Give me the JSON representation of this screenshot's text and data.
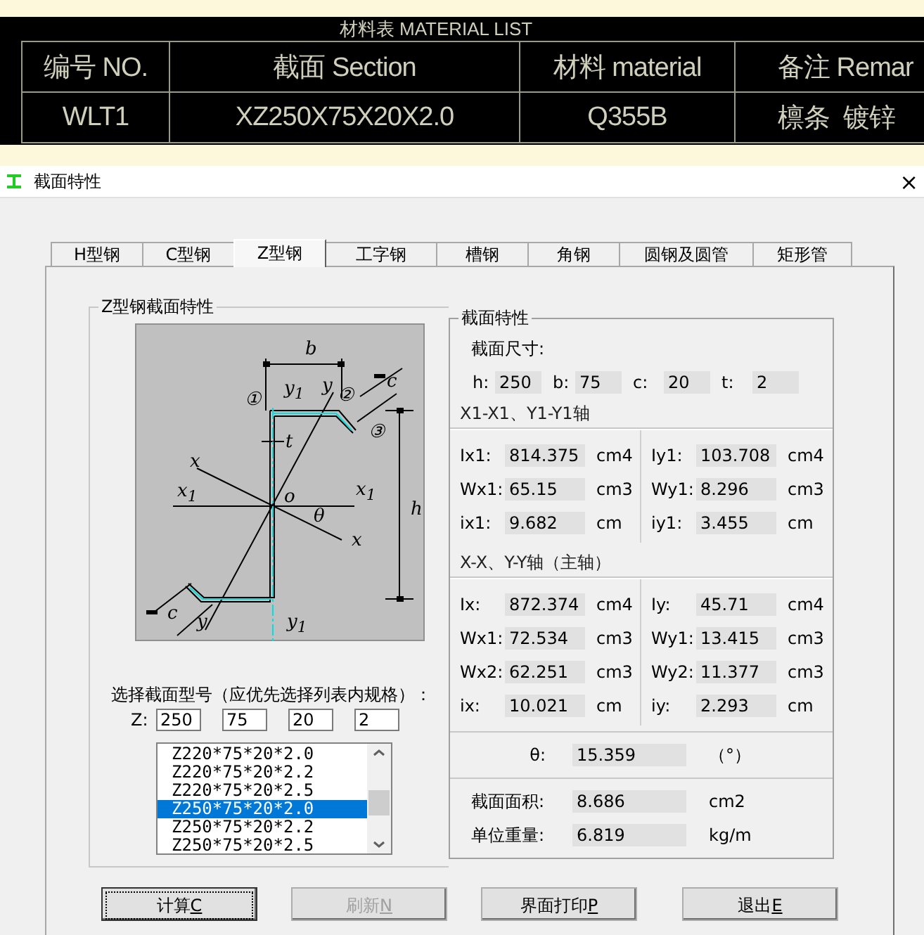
{
  "cad": {
    "title": "材料表 MATERIAL LIST",
    "columns": [
      "编号 NO.",
      "截面 Section",
      "材料 material",
      "备注 Remar"
    ],
    "row": [
      "WLT1",
      "XZ250X75X20X2.0",
      "Q355B",
      "檩条  镀锌"
    ]
  },
  "window": {
    "title": "截面特性",
    "close": "×"
  },
  "tabs": [
    {
      "label": "H型钢",
      "selected": false
    },
    {
      "label": "C型钢",
      "selected": false
    },
    {
      "label": "Z型钢",
      "selected": true
    },
    {
      "label": "工字钢",
      "selected": false
    },
    {
      "label": "槽钢",
      "selected": false
    },
    {
      "label": "角钢",
      "selected": false
    },
    {
      "label": "圆钢及圆管",
      "selected": false
    },
    {
      "label": "矩形管",
      "selected": false
    }
  ],
  "section_group": {
    "title": "Z型钢截面特性",
    "diagram_labels": [
      "b",
      "y$_{1}$",
      "y",
      "①",
      "②",
      "③",
      "c",
      "t",
      "x",
      "x$_{1}$",
      "o",
      "x$_{1}$",
      "θ",
      "x",
      "h",
      "c",
      "y",
      "y$_{1}$"
    ],
    "prompt": "选择截面型号（应优先选择列表内规格）：",
    "prefix": "Z:",
    "inputs": [
      "250",
      "75",
      "20",
      "2"
    ],
    "list": [
      {
        "label": "Z220*75*20*2.0",
        "selected": false
      },
      {
        "label": "Z220*75*20*2.2",
        "selected": false
      },
      {
        "label": "Z220*75*20*2.5",
        "selected": false
      },
      {
        "label": "Z250*75*20*2.0",
        "selected": true
      },
      {
        "label": "Z250*75*20*2.2",
        "selected": false
      },
      {
        "label": "Z250*75*20*2.5",
        "selected": false
      }
    ]
  },
  "properties": {
    "title": "截面特性",
    "size_label": "截面尺寸:",
    "dims": [
      {
        "label": "h:",
        "value": "250"
      },
      {
        "label": "b:",
        "value": "75"
      },
      {
        "label": "c:",
        "value": "20"
      },
      {
        "label": "t:",
        "value": "2"
      }
    ],
    "sections": [
      {
        "title": "X1-X1、Y1-Y1轴",
        "left": [
          {
            "label": "Ix1:",
            "value": "814.375",
            "unit": "cm4"
          },
          {
            "label": "Wx1:",
            "value": "65.15",
            "unit": "cm3"
          },
          {
            "label": "ix1:",
            "value": "9.682",
            "unit": "cm"
          }
        ],
        "right": [
          {
            "label": "Iy1:",
            "value": "103.708",
            "unit": "cm4"
          },
          {
            "label": "Wy1:",
            "value": "8.296",
            "unit": "cm3"
          },
          {
            "label": "iy1:",
            "value": "3.455",
            "unit": "cm"
          }
        ]
      },
      {
        "title": "X-X、Y-Y轴（主轴）",
        "left": [
          {
            "label": "Ix:",
            "value": "872.374",
            "unit": "cm4"
          },
          {
            "label": "Wx1:",
            "value": "72.534",
            "unit": "cm3"
          },
          {
            "label": "Wx2:",
            "value": "62.251",
            "unit": "cm3"
          },
          {
            "label": "ix:",
            "value": "10.021",
            "unit": "cm"
          }
        ],
        "right": [
          {
            "label": "Iy:",
            "value": "45.71",
            "unit": "cm4"
          },
          {
            "label": "Wy1:",
            "value": "13.415",
            "unit": "cm3"
          },
          {
            "label": "Wy2:",
            "value": "11.377",
            "unit": "cm3"
          },
          {
            "label": "iy:",
            "value": "2.293",
            "unit": "cm"
          }
        ]
      }
    ],
    "theta": {
      "label": "θ:",
      "value": "15.359",
      "unit": "（°）"
    },
    "totals": [
      {
        "label": "截面面积:",
        "value": "8.686",
        "unit": "cm2"
      },
      {
        "label": "单位重量:",
        "value": "6.819",
        "unit": "kg/m"
      }
    ]
  },
  "buttons": [
    {
      "label": "计算",
      "key": "C",
      "disabled": false,
      "focused": true
    },
    {
      "label": "刷新",
      "key": "N",
      "disabled": true,
      "focused": false
    },
    {
      "label": "界面打印",
      "key": "P",
      "disabled": false,
      "focused": false
    },
    {
      "label": "退出",
      "key": "E",
      "disabled": false,
      "focused": false
    }
  ]
}
